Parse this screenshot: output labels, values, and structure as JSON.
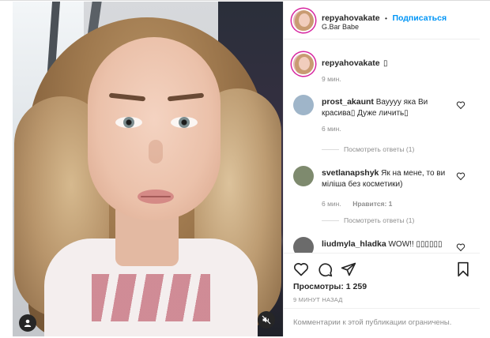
{
  "post": {
    "author": "repyahovakate",
    "follow_label": "Подписаться",
    "separator": "•",
    "location": "G.Bar Babe",
    "caption_emoji": "▯",
    "caption_time": "9 мин."
  },
  "comments": [
    {
      "username": "prost_akaunt",
      "text": "Вауууу яка Ви красива▯ Дуже личить▯",
      "time": "6 мин.",
      "like_label": "",
      "replies_label": "Посмотреть ответы (1)"
    },
    {
      "username": "svetlanapshyk",
      "text": "Як на мене, то ви міліша без косметики)",
      "time": "6 мин.",
      "like_label": "Нравится: 1",
      "replies_label": "Посмотреть ответы (1)"
    },
    {
      "username": "liudmyla_hladka",
      "text": "WOW!! ▯▯▯▯▯▯"
    }
  ],
  "stats": {
    "views": "Просмотры: 1 259",
    "posted_ago": "9 МИНУТ НАЗАД"
  },
  "footer": {
    "notice": "Комментарии к этой публикации ограничены."
  },
  "icons": {
    "like": "heart-icon",
    "comment": "comment-icon",
    "share": "paper-plane-icon",
    "save": "bookmark-icon",
    "user_tag": "user-icon",
    "mute": "speaker-muted-icon"
  },
  "colors": {
    "link_blue": "#0095f6",
    "text": "#262626",
    "muted": "#8e8e8e",
    "border": "#efefef"
  }
}
